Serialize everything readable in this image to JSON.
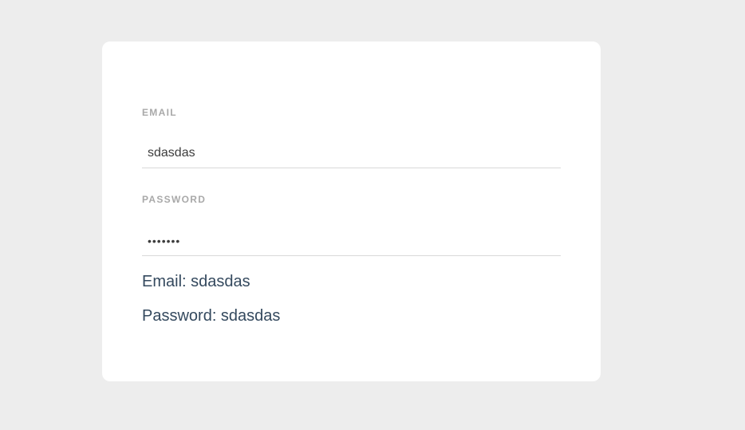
{
  "form": {
    "email_label": "EMAIL",
    "email_value": "sdasdas",
    "password_label": "PASSWORD",
    "password_value": "sdasdas"
  },
  "output": {
    "email_line": "Email: sdasdas",
    "password_line": "Password: sdasdas"
  },
  "colors": {
    "page_background": "#ededed",
    "card_background": "#ffffff",
    "label_color": "#a9a9a9",
    "output_text_color": "#34495e"
  }
}
